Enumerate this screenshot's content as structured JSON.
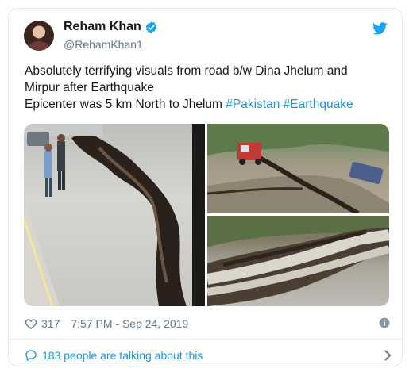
{
  "author": {
    "display_name": "Reham Khan",
    "handle": "@RehamKhan1",
    "verified": true
  },
  "icons": {
    "avatar": "profile-photo",
    "verified": "verified-badge-icon",
    "brand": "twitter-bird-icon",
    "like": "heart-icon",
    "info": "info-icon",
    "talk": "speech-bubble-icon",
    "chevron": "chevron-right-icon"
  },
  "tweet": {
    "line1": "Absolutely terrifying visuals from road  b/w Dina Jhelum and",
    "line2": "Mirpur after Earthquake",
    "line3_text": "Epicenter was 5 km North to Jhelum ",
    "hashtags": [
      "#Pakistan",
      "#Earthquake"
    ]
  },
  "media": {
    "count": 3,
    "descriptions_visible": false
  },
  "meta": {
    "likes": "317",
    "timestamp": "7:57 PM - Sep 24, 2019"
  },
  "conversation": {
    "label": "183 people are talking about this"
  },
  "colors": {
    "brand_blue": "#1da1f2",
    "link_blue": "#1b95e0",
    "text_primary": "#14171a",
    "text_secondary": "#657786",
    "border": "#e1e8ed"
  }
}
